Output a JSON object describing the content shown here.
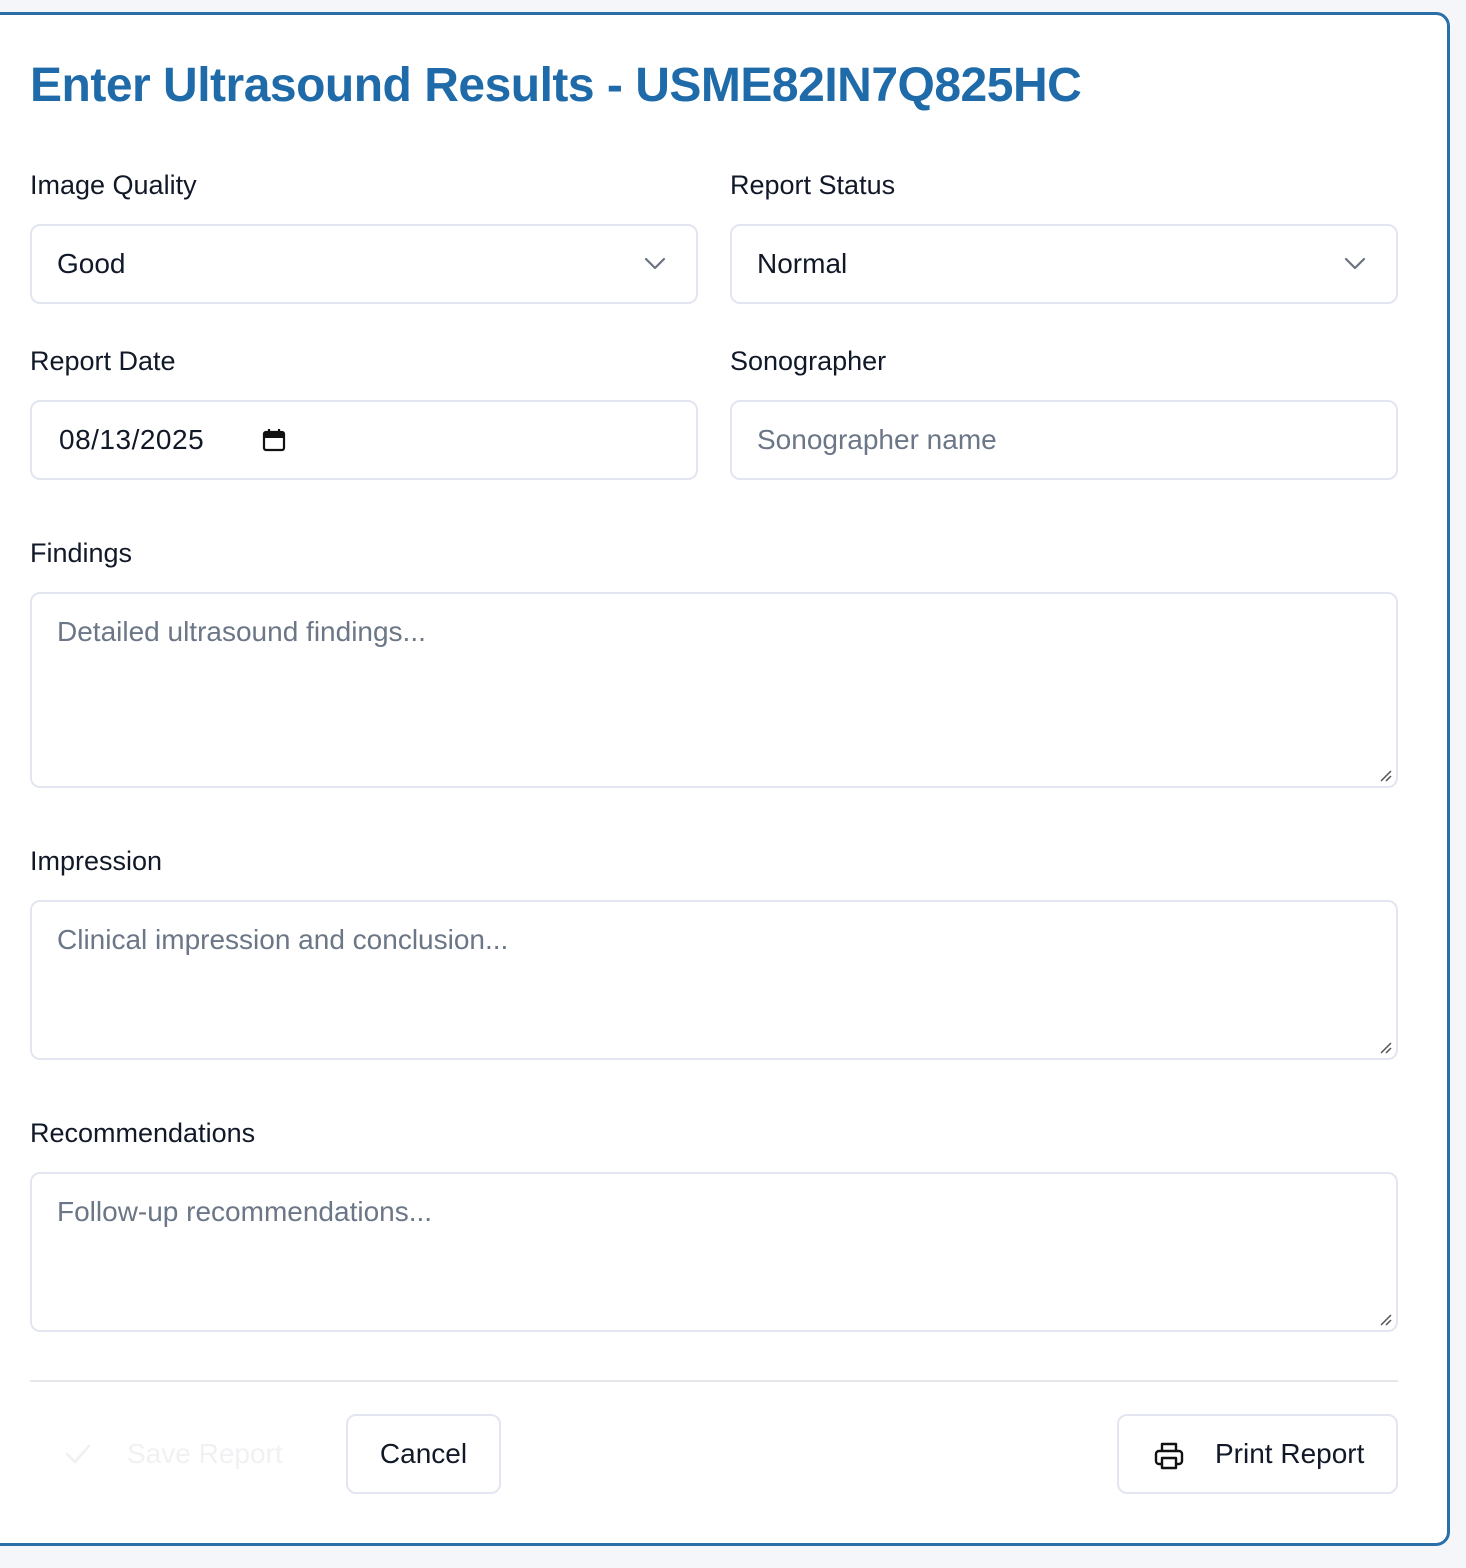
{
  "dialog": {
    "title": "Enter Ultrasound Results - USME82IN7Q825HC"
  },
  "form": {
    "image_quality": {
      "label": "Image Quality",
      "value": "Good"
    },
    "report_status": {
      "label": "Report Status",
      "value": "Normal"
    },
    "report_date": {
      "label": "Report Date",
      "value": "08/13/2025"
    },
    "sonographer": {
      "label": "Sonographer",
      "placeholder": "Sonographer name"
    },
    "findings": {
      "label": "Findings",
      "placeholder": "Detailed ultrasound findings..."
    },
    "impression": {
      "label": "Impression",
      "placeholder": "Clinical impression and conclusion..."
    },
    "recommendations": {
      "label": "Recommendations",
      "placeholder": "Follow-up recommendations..."
    }
  },
  "actions": {
    "save_label": "Save Report",
    "cancel_label": "Cancel",
    "print_label": "Print Report"
  },
  "colors": {
    "accent": "#1f6aa8",
    "border": "#2a6fa8",
    "field_border": "#e3e6f0",
    "placeholder": "#6b7686"
  },
  "icons": {
    "dropdown": "chevron-down-icon",
    "date": "calendar-icon",
    "save": "check-icon",
    "print": "printer-icon",
    "resize": "resize-handle-icon"
  }
}
